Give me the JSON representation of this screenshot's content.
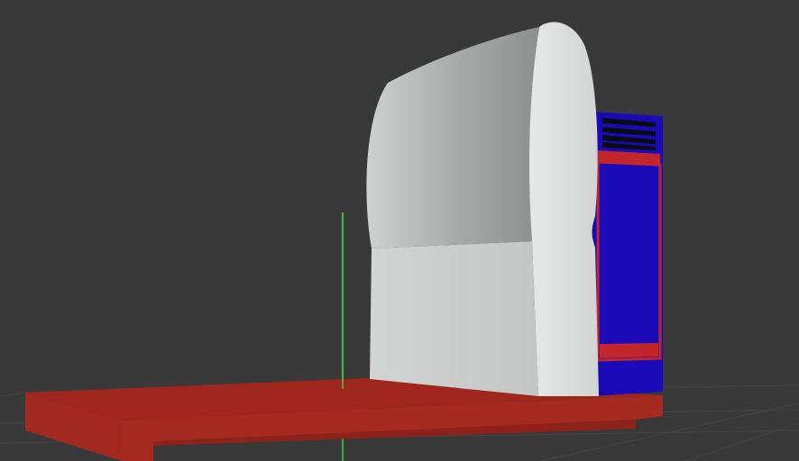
{
  "viewport": {
    "background_color": "#393939",
    "grid_color": "#444444",
    "axis_y_color": "#3fd23f"
  },
  "scene": {
    "objects": [
      {
        "name": "base-platform",
        "color": "#a2291f"
      },
      {
        "name": "housing-body",
        "color": "#d6d8d8"
      },
      {
        "name": "control-panel",
        "color": "#1a0ab8"
      },
      {
        "name": "control-panel-trim",
        "color": "#c0262a"
      },
      {
        "name": "vent-slots",
        "color": "#0b0b14"
      }
    ]
  }
}
